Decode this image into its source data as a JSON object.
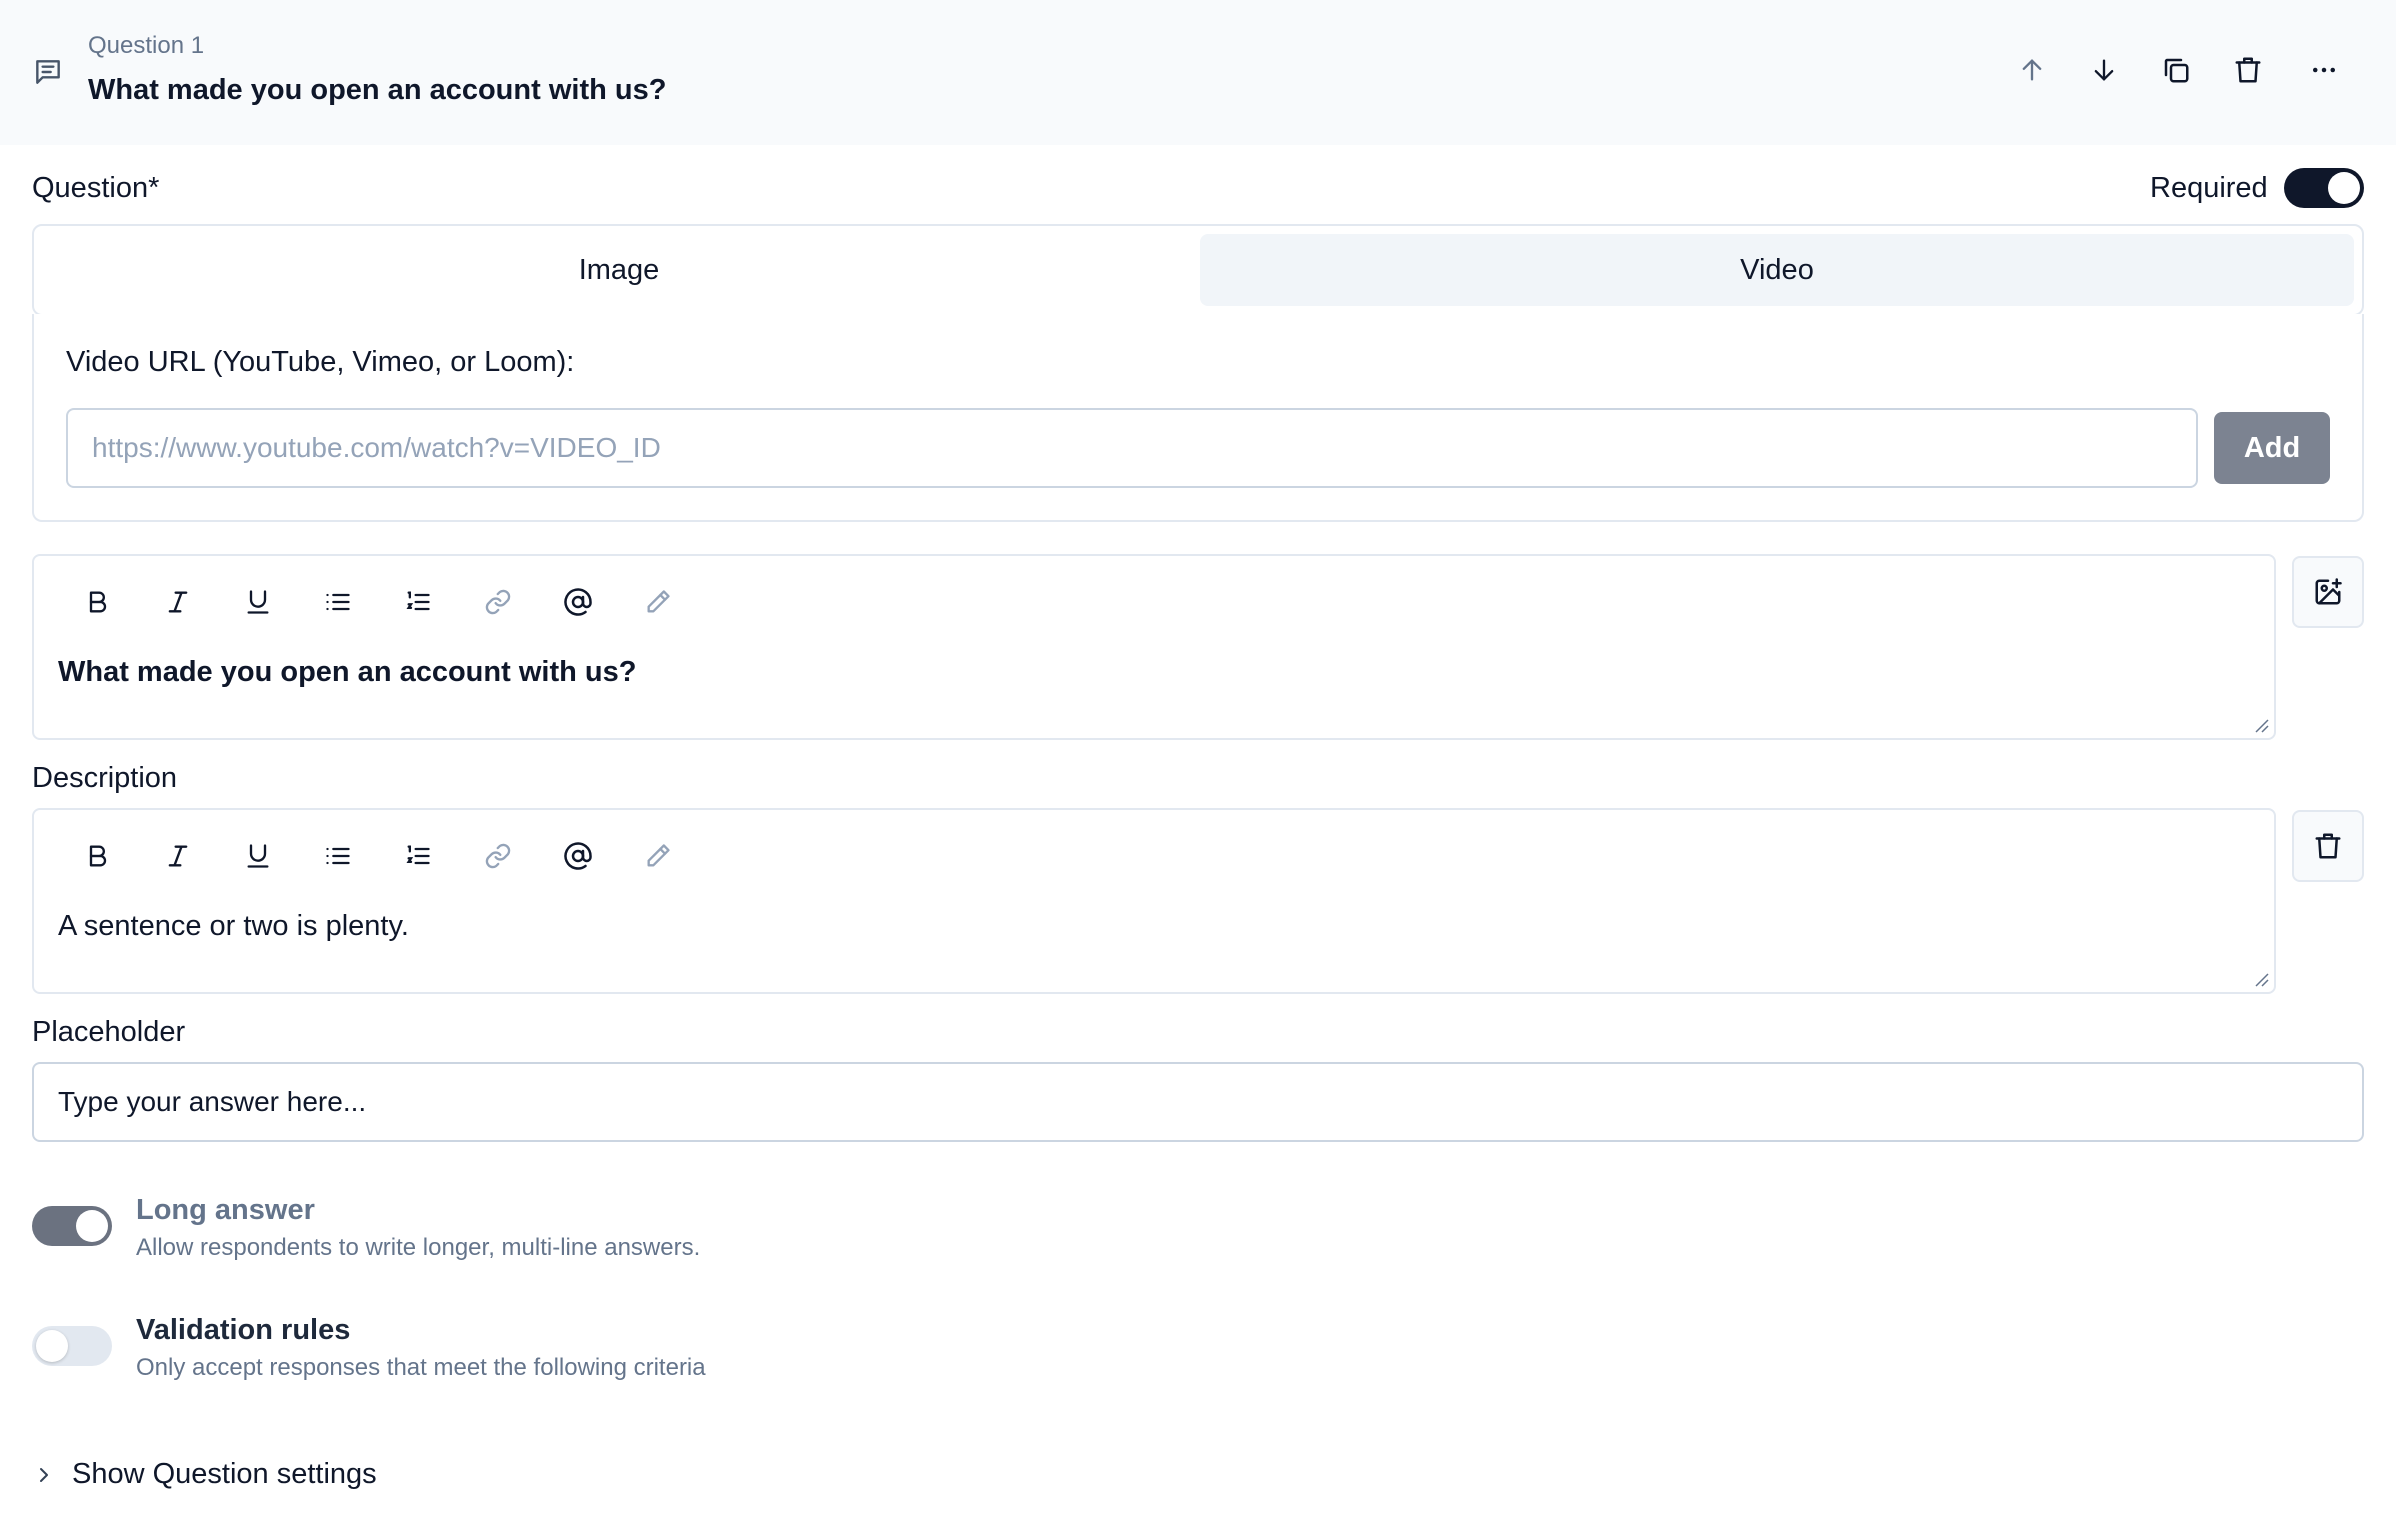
{
  "header": {
    "question_number": "Question 1",
    "question_title": "What made you open an account with us?"
  },
  "question_section": {
    "label": "Question*",
    "required_label": "Required",
    "required_on": true
  },
  "media_tabs": [
    {
      "label": "Image",
      "active": false
    },
    {
      "label": "Video",
      "active": true
    }
  ],
  "video": {
    "url_label": "Video URL (YouTube, Vimeo, or Loom):",
    "url_placeholder": "https://www.youtube.com/watch?v=VIDEO_ID",
    "url_value": "",
    "add_label": "Add"
  },
  "question_editor": {
    "content": "What made you open an account with us?"
  },
  "description": {
    "label": "Description",
    "content": "A sentence or two is plenty."
  },
  "placeholder": {
    "label": "Placeholder",
    "value": "Type your answer here..."
  },
  "options": {
    "long_answer": {
      "title": "Long answer",
      "description": "Allow respondents to write longer, multi-line answers.",
      "enabled": true,
      "disabled_state": true
    },
    "validation": {
      "title": "Validation rules",
      "description": "Only accept responses that meet the following criteria",
      "enabled": false
    }
  },
  "settings_link": "Show Question settings",
  "toolbar_icons": [
    "bold-icon",
    "italic-icon",
    "underline-icon",
    "bullet-list-icon",
    "ordered-list-icon",
    "link-icon",
    "mention-icon",
    "highlight-pen-icon"
  ],
  "colors": {
    "toggle_on": "#0f172a",
    "toggle_disabled": "#6b7280",
    "toggle_off": "#e2e8f0",
    "add_button": "#7c8391",
    "tab_active_bg": "#f1f5f9"
  }
}
